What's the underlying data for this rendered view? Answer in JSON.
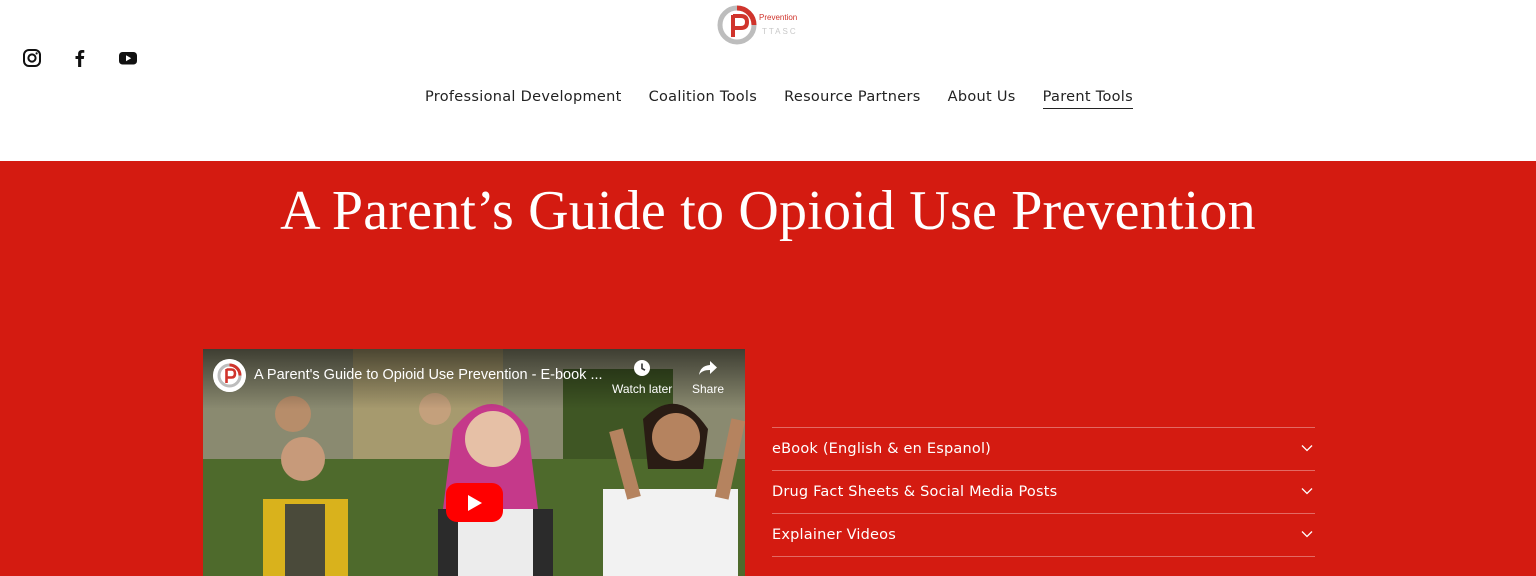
{
  "logo": {
    "line1": "Prevention",
    "line2": "TTASC"
  },
  "social": [
    "instagram-icon",
    "facebook-icon",
    "youtube-icon"
  ],
  "nav": {
    "items": [
      {
        "label": "Professional Development"
      },
      {
        "label": "Coalition Tools"
      },
      {
        "label": "Resource Partners"
      },
      {
        "label": "About Us"
      },
      {
        "label": "Parent Tools",
        "active": true
      }
    ]
  },
  "hero": {
    "title": "A Parent’s Guide to Opioid Use Prevention"
  },
  "video": {
    "title": "A Parent's Guide to Opioid Use Prevention - E-book ...",
    "watch_later": "Watch later",
    "share": "Share"
  },
  "accordion": {
    "items": [
      {
        "label": "eBook (English & en Espanol)"
      },
      {
        "label": "Drug Fact Sheets & Social Media Posts"
      },
      {
        "label": "Explainer Videos"
      }
    ]
  },
  "colors": {
    "brand_red": "#d41b11",
    "youtube_red": "#ff0000"
  }
}
